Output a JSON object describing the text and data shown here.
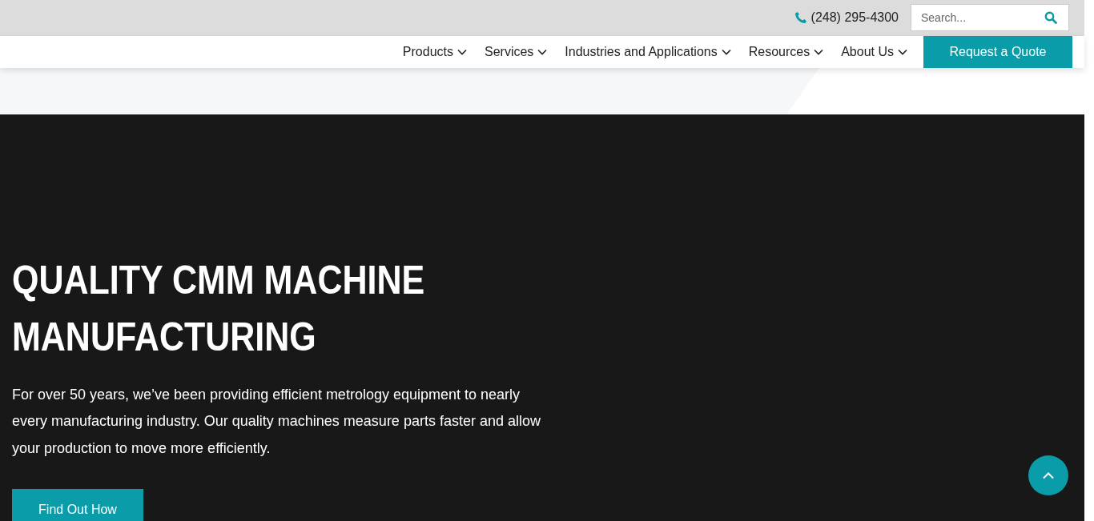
{
  "top_bar": {
    "phone": "(248) 295-4300",
    "search": {
      "placeholder": "Search..."
    }
  },
  "nav": {
    "items": [
      {
        "label": "Products"
      },
      {
        "label": "Services"
      },
      {
        "label": "Industries and Applications"
      },
      {
        "label": "Resources"
      },
      {
        "label": "About Us"
      }
    ],
    "cta": "Request a Quote"
  },
  "hero": {
    "title_lines": [
      "QUALITY CMM MACHINE",
      "MANUFACTURING"
    ],
    "text": "For over 50 years, we’ve been providing efficient metrology equipment to nearly every manufacturing industry. Our quality machines measure parts faster and allow your production to move more efficiently.",
    "button": "Find Out How"
  }
}
